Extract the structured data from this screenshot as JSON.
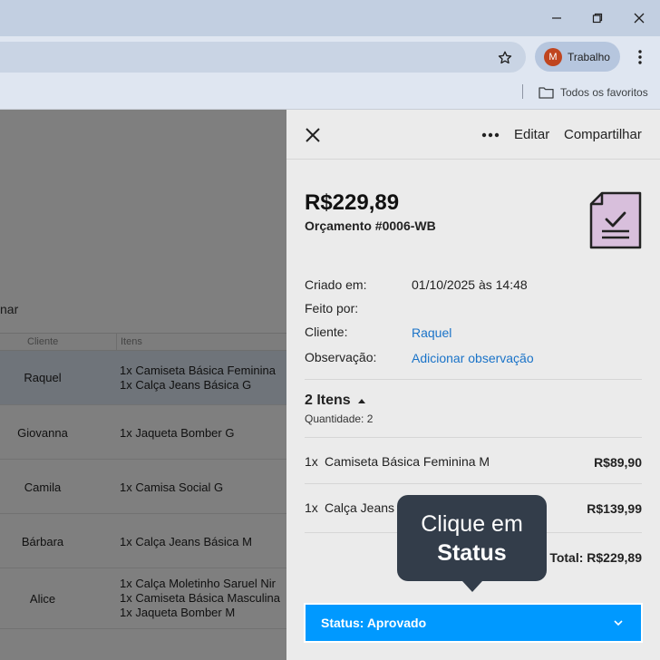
{
  "browser": {
    "profile": {
      "initial": "M",
      "name": "Trabalho"
    },
    "bookmarks": {
      "all_label": "Todos os favoritos"
    }
  },
  "page": {
    "partial_label": "nar",
    "table": {
      "headers": {
        "client": "Cliente",
        "items": "Itens"
      },
      "rows": [
        {
          "client": "Raquel",
          "items": [
            "1x Camiseta Básica Feminina",
            "1x Calça Jeans Básica G"
          ],
          "selected": true
        },
        {
          "client": "Giovanna",
          "items": [
            "1x Jaqueta Bomber G"
          ]
        },
        {
          "client": "Camila",
          "items": [
            "1x Camisa Social G"
          ]
        },
        {
          "client": "Bárbara",
          "items": [
            "1x Calça Jeans Básica M"
          ]
        },
        {
          "client": "Alice",
          "items": [
            "1x Calça Moletinho Saruel Nir",
            "1x Camiseta Básica Masculina",
            "1x Jaqueta Bomber M"
          ]
        }
      ]
    }
  },
  "panel": {
    "edit_label": "Editar",
    "share_label": "Compartilhar",
    "amount": "R$229,89",
    "quote_number": "Orçamento #0006-WB",
    "info": {
      "created_label": "Criado em:",
      "created_value": "01/10/2025 às 14:48",
      "made_by_label": "Feito por:",
      "made_by_value": "",
      "client_label": "Cliente:",
      "client_value": "Raquel",
      "note_label": "Observação:",
      "note_value": "Adicionar observação"
    },
    "items_heading": "2 Itens",
    "quantity_label": "Quantidade: 2",
    "lines": [
      {
        "qty": "1x",
        "name": "Camiseta Básica Feminina M",
        "price": "R$89,90"
      },
      {
        "qty": "1x",
        "name": "Calça Jeans",
        "price": "R$139,99"
      }
    ],
    "total": "Total: R$229,89",
    "status_label": "Status: Aprovado"
  },
  "tooltip": {
    "line1": "Clique em",
    "line2": "Status"
  },
  "colors": {
    "status_blue": "#0099ff",
    "tooltip_bg": "#333d4a",
    "link_blue": "#1a73c8",
    "doc_icon_fill": "#d8bfdc"
  }
}
